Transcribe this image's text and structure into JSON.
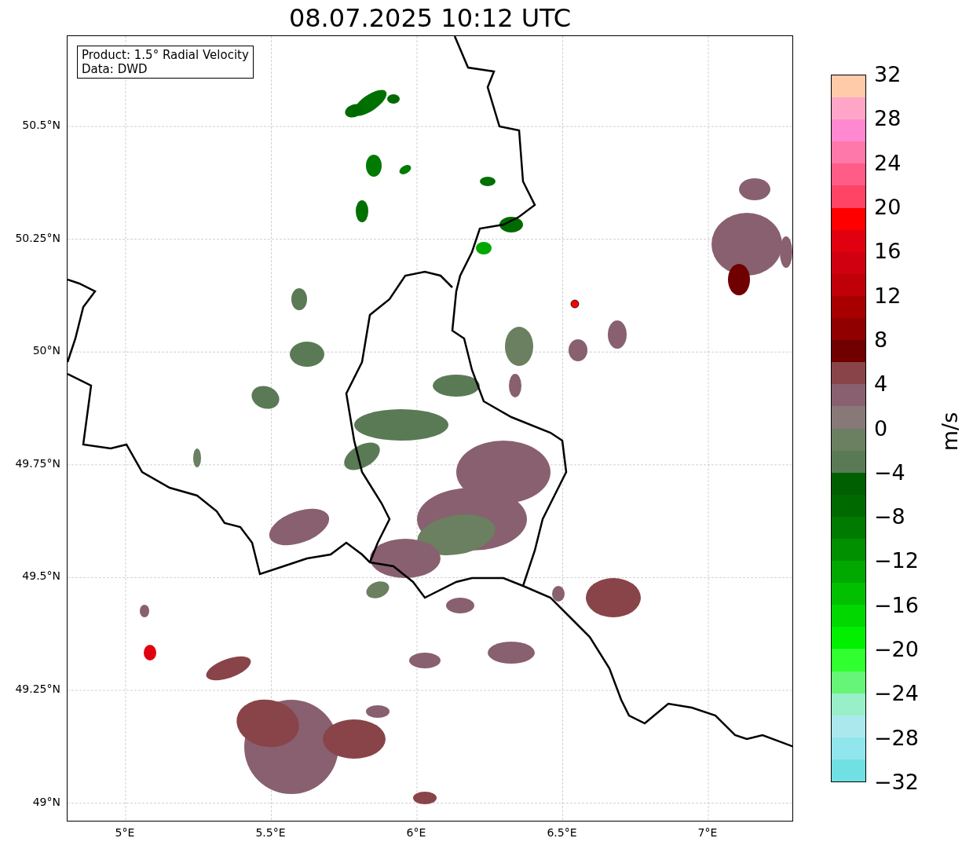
{
  "title": "08.07.2025 10:12 UTC",
  "info_box": [
    "Product: 1.5° Radial Velocity",
    "Data: DWD"
  ],
  "y_ticks": [
    "50.5°N",
    "50.25°N",
    "50°N",
    "49.75°N",
    "49.5°N",
    "49.25°N",
    "49°N"
  ],
  "x_ticks": [
    "5°E",
    "5.5°E",
    "6°E",
    "6.5°E",
    "7°E"
  ],
  "colorbar": {
    "label": "m/s",
    "ticks": [
      "32",
      "28",
      "24",
      "20",
      "16",
      "12",
      "8",
      "4",
      "0",
      "−4",
      "−8",
      "−12",
      "−16",
      "−20",
      "−24",
      "−28",
      "−32"
    ],
    "bands": [
      {
        "color": "#ffcba8"
      },
      {
        "color": "#ffa6c8"
      },
      {
        "color": "#ff88d0"
      },
      {
        "color": "#ff78aa"
      },
      {
        "color": "#ff5c88"
      },
      {
        "color": "#ff4466"
      },
      {
        "color": "#ff0000"
      },
      {
        "color": "#e00010"
      },
      {
        "color": "#d00010"
      },
      {
        "color": "#c00008"
      },
      {
        "color": "#a80000"
      },
      {
        "color": "#900000"
      },
      {
        "color": "#700000"
      },
      {
        "color": "#884448"
      },
      {
        "color": "#886070"
      },
      {
        "color": "#887878"
      },
      {
        "color": "#6a8060"
      },
      {
        "color": "#5a7a55"
      },
      {
        "color": "#005f00"
      },
      {
        "color": "#006a00"
      },
      {
        "color": "#007a00"
      },
      {
        "color": "#009000"
      },
      {
        "color": "#00a800"
      },
      {
        "color": "#00c000"
      },
      {
        "color": "#00d800"
      },
      {
        "color": "#00f000"
      },
      {
        "color": "#30ff30"
      },
      {
        "color": "#66f577"
      },
      {
        "color": "#99f0c8"
      },
      {
        "color": "#aae8ee"
      },
      {
        "color": "#90e6ec"
      },
      {
        "color": "#70e0e4"
      }
    ]
  }
}
